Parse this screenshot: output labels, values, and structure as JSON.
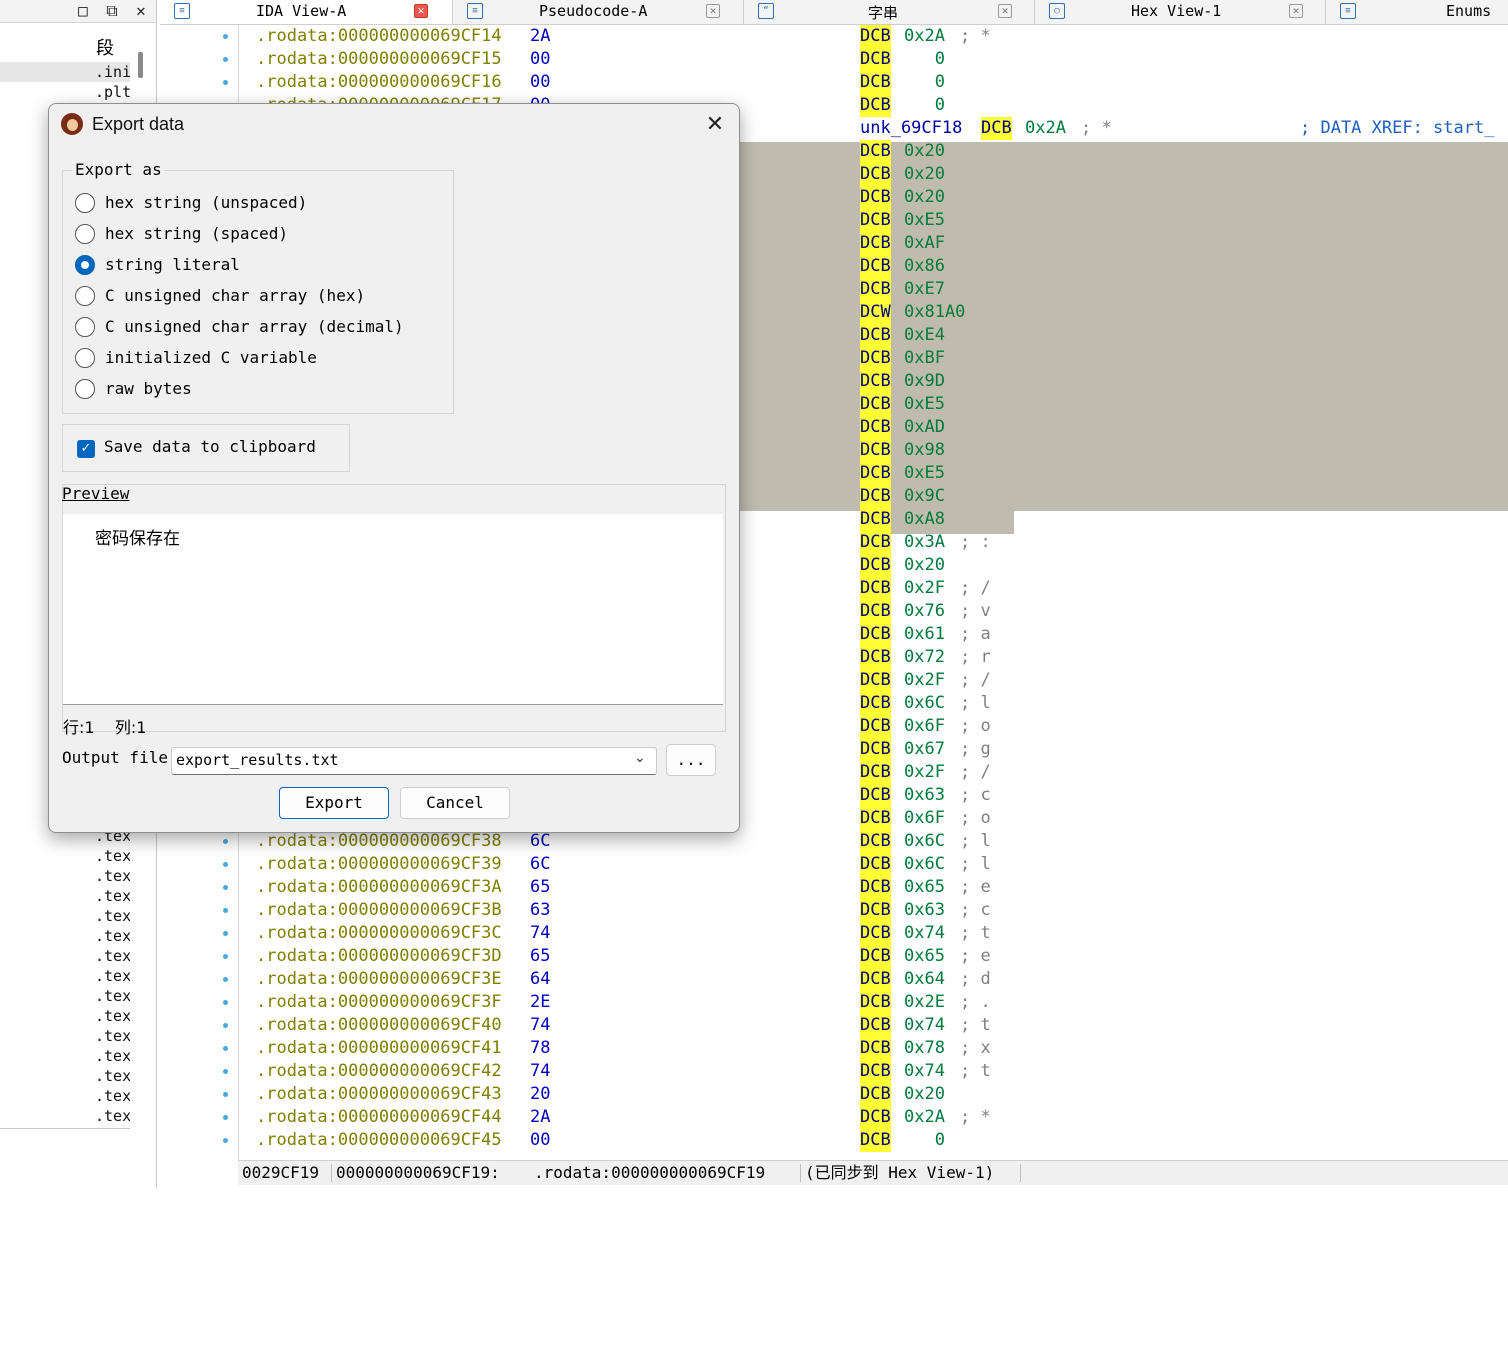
{
  "segments_pane": {
    "header": "段",
    "rows": [
      ".ini",
      ".plt"
    ],
    "rows_bottom": [
      ".tex",
      ".tex",
      ".tex",
      ".tex",
      ".tex",
      ".tex",
      ".tex",
      ".tex",
      ".tex",
      ".tex",
      ".tex",
      ".tex",
      ".tex",
      ".tex",
      ".tex"
    ]
  },
  "tabs": [
    {
      "label": "IDA View-A",
      "active": true
    },
    {
      "label": "Pseudocode-A",
      "active": false
    },
    {
      "label": "字串",
      "active": false
    },
    {
      "label": "Hex View-1",
      "active": false
    },
    {
      "label": "Enums",
      "active": false
    }
  ],
  "disasm": {
    "top_rows": [
      {
        "addr": ".rodata:000000000069CF14",
        "byte": "2A",
        "kw": "DCB",
        "num": "0x2A",
        "cmt": "; *"
      },
      {
        "addr": ".rodata:000000000069CF15",
        "byte": "00",
        "kw": "DCB",
        "num": "   0",
        "cmt": ""
      },
      {
        "addr": ".rodata:000000000069CF16",
        "byte": "00",
        "kw": "DCB",
        "num": "   0",
        "cmt": ""
      },
      {
        "addr": ".rodata:000000000069CF17",
        "byte": "00",
        "kw": "DCB",
        "num": "   0",
        "cmt": ""
      }
    ],
    "label_row": {
      "label": "unk_69CF18",
      "kw": "DCB",
      "num": "0x2A",
      "cmt": "; *",
      "xref": "; DATA XREF: start_"
    },
    "selected_rows": [
      {
        "kw": "DCB",
        "num": "0x20"
      },
      {
        "kw": "DCB",
        "num": "0x20"
      },
      {
        "kw": "DCB",
        "num": "0x20"
      },
      {
        "kw": "DCB",
        "num": "0xE5"
      },
      {
        "kw": "DCB",
        "num": "0xAF"
      },
      {
        "kw": "DCB",
        "num": "0x86"
      },
      {
        "kw": "DCB",
        "num": "0xE7"
      },
      {
        "kw": "DCW",
        "num": "0x81A0"
      },
      {
        "kw": "DCB",
        "num": "0xE4"
      },
      {
        "kw": "DCB",
        "num": "0xBF"
      },
      {
        "kw": "DCB",
        "num": "0x9D"
      },
      {
        "kw": "DCB",
        "num": "0xE5"
      },
      {
        "kw": "DCB",
        "num": "0xAD"
      },
      {
        "kw": "DCB",
        "num": "0x98"
      },
      {
        "kw": "DCB",
        "num": "0xE5"
      },
      {
        "kw": "DCB",
        "num": "0x9C"
      },
      {
        "kw": "DCB",
        "num": "0xA8"
      }
    ],
    "after_rows": [
      {
        "kw": "DCB",
        "num": "0x3A",
        "cmt": "; :"
      },
      {
        "kw": "DCB",
        "num": "0x20",
        "cmt": ""
      },
      {
        "kw": "DCB",
        "num": "0x2F",
        "cmt": "; /"
      },
      {
        "kw": "DCB",
        "num": "0x76",
        "cmt": "; v"
      },
      {
        "kw": "DCB",
        "num": "0x61",
        "cmt": "; a"
      },
      {
        "kw": "DCB",
        "num": "0x72",
        "cmt": "; r"
      },
      {
        "kw": "DCB",
        "num": "0x2F",
        "cmt": "; /"
      },
      {
        "kw": "DCB",
        "num": "0x6C",
        "cmt": "; l"
      },
      {
        "kw": "DCB",
        "num": "0x6F",
        "cmt": "; o"
      },
      {
        "kw": "DCB",
        "num": "0x67",
        "cmt": "; g"
      },
      {
        "kw": "DCB",
        "num": "0x2F",
        "cmt": "; /"
      },
      {
        "kw": "DCB",
        "num": "0x63",
        "cmt": "; c"
      },
      {
        "kw": "DCB",
        "num": "0x6F",
        "cmt": "; o"
      }
    ],
    "bottom_rows": [
      {
        "addr": ".rodata:000000000069CF38",
        "byte": "6C",
        "kw": "DCB",
        "num": "0x6C",
        "cmt": "; l"
      },
      {
        "addr": ".rodata:000000000069CF39",
        "byte": "6C",
        "kw": "DCB",
        "num": "0x6C",
        "cmt": "; l"
      },
      {
        "addr": ".rodata:000000000069CF3A",
        "byte": "65",
        "kw": "DCB",
        "num": "0x65",
        "cmt": "; e"
      },
      {
        "addr": ".rodata:000000000069CF3B",
        "byte": "63",
        "kw": "DCB",
        "num": "0x63",
        "cmt": "; c"
      },
      {
        "addr": ".rodata:000000000069CF3C",
        "byte": "74",
        "kw": "DCB",
        "num": "0x74",
        "cmt": "; t"
      },
      {
        "addr": ".rodata:000000000069CF3D",
        "byte": "65",
        "kw": "DCB",
        "num": "0x65",
        "cmt": "; e"
      },
      {
        "addr": ".rodata:000000000069CF3E",
        "byte": "64",
        "kw": "DCB",
        "num": "0x64",
        "cmt": "; d"
      },
      {
        "addr": ".rodata:000000000069CF3F",
        "byte": "2E",
        "kw": "DCB",
        "num": "0x2E",
        "cmt": "; ."
      },
      {
        "addr": ".rodata:000000000069CF40",
        "byte": "74",
        "kw": "DCB",
        "num": "0x74",
        "cmt": "; t"
      },
      {
        "addr": ".rodata:000000000069CF41",
        "byte": "78",
        "kw": "DCB",
        "num": "0x78",
        "cmt": "; x"
      },
      {
        "addr": ".rodata:000000000069CF42",
        "byte": "74",
        "kw": "DCB",
        "num": "0x74",
        "cmt": "; t"
      },
      {
        "addr": ".rodata:000000000069CF43",
        "byte": "20",
        "kw": "DCB",
        "num": "0x20",
        "cmt": ""
      },
      {
        "addr": ".rodata:000000000069CF44",
        "byte": "2A",
        "kw": "DCB",
        "num": "0x2A",
        "cmt": "; *"
      },
      {
        "addr": ".rodata:000000000069CF45",
        "byte": "00",
        "kw": "DCB",
        "num": "   0",
        "cmt": ""
      }
    ]
  },
  "statusbar": {
    "offset": "0029CF19",
    "address": "000000000069CF19:",
    "location": ".rodata:000000000069CF19",
    "sync": "(已同步到 Hex View-1)"
  },
  "dialog": {
    "title": "Export data",
    "export_as_label": "Export as",
    "options": [
      {
        "label": "hex string (unspaced)",
        "selected": false
      },
      {
        "label": "hex string (spaced)",
        "selected": false
      },
      {
        "label": "string literal",
        "selected": true
      },
      {
        "label": "C unsigned char array (hex)",
        "selected": false
      },
      {
        "label": "C unsigned char array (decimal)",
        "selected": false
      },
      {
        "label": "initialized C variable",
        "selected": false
      },
      {
        "label": "raw bytes",
        "selected": false
      }
    ],
    "clipboard_label": "Save data to clipboard",
    "clipboard_checked": true,
    "preview_label": "Preview",
    "preview_text": "密码保存在",
    "row_col": "行:1    列:1",
    "output_label": "Output file",
    "output_value": "export_results.txt",
    "browse_label": "...",
    "export_button": "Export",
    "cancel_button": "Cancel"
  },
  "colors": {
    "address": "#808000",
    "byte": "#0000c0",
    "keyword_bg": "#ffff33",
    "number": "#007a3d",
    "selection": "#bfbcaf",
    "accent": "#0067c0"
  }
}
